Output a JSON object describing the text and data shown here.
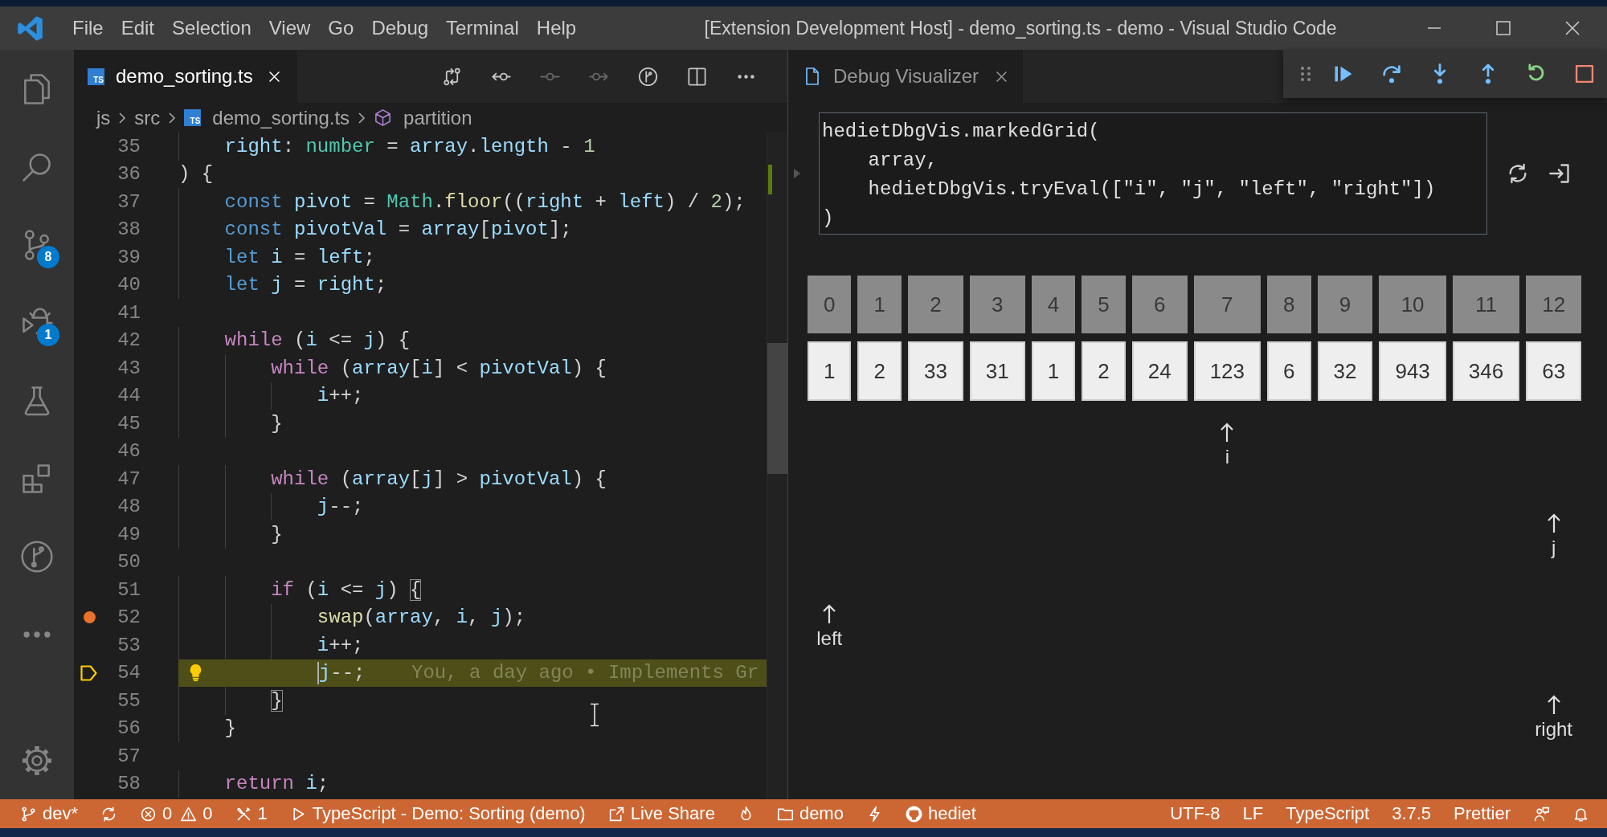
{
  "title_bar": {
    "menu": [
      "File",
      "Edit",
      "Selection",
      "View",
      "Go",
      "Debug",
      "Terminal",
      "Help"
    ],
    "title": "[Extension Development Host] - demo_sorting.ts - demo - Visual Studio Code"
  },
  "activity_bar": {
    "items": [
      {
        "kind": "files",
        "selected": false
      },
      {
        "kind": "search",
        "selected": false
      },
      {
        "kind": "source-control",
        "selected": false,
        "badge": "8"
      },
      {
        "kind": "debug",
        "selected": false,
        "badge": "1"
      },
      {
        "kind": "test",
        "selected": false
      },
      {
        "kind": "extensions",
        "selected": false
      },
      {
        "kind": "git-graph",
        "selected": false
      },
      {
        "kind": "more",
        "selected": false
      },
      {
        "kind": "settings",
        "selected": false
      }
    ]
  },
  "editor": {
    "tabs": [
      {
        "label": "demo_sorting.ts",
        "badge": "TS",
        "selected": true
      }
    ],
    "actions": [
      {
        "kind": "open-changes",
        "disabled": false
      },
      {
        "kind": "previous-revision",
        "disabled": false
      },
      {
        "kind": "revision",
        "disabled": true
      },
      {
        "kind": "next-revision",
        "disabled": true
      },
      {
        "kind": "history",
        "disabled": false
      },
      {
        "kind": "split",
        "disabled": false
      },
      {
        "kind": "more",
        "disabled": false
      }
    ],
    "breadcrumbs": [
      {
        "kind": "folder",
        "label": "js"
      },
      {
        "kind": "folder",
        "label": "src"
      },
      {
        "kind": "file",
        "label": "demo_sorting.ts",
        "badge": "TS"
      },
      {
        "kind": "symbol",
        "label": "partition"
      }
    ],
    "lines": [
      {
        "number": "35",
        "breakpoint": false,
        "current": false,
        "tokens": [
          {
            "text": "    right",
            "kind": "variable"
          },
          {
            "text": ": ",
            "kind": "punctuation"
          },
          {
            "text": "number",
            "kind": "type"
          },
          {
            "text": " = ",
            "kind": "punctuation"
          },
          {
            "text": "array",
            "kind": "variable"
          },
          {
            "text": ".",
            "kind": "punctuation"
          },
          {
            "text": "length",
            "kind": "variable"
          },
          {
            "text": " - ",
            "kind": "punctuation"
          },
          {
            "text": "1",
            "kind": "number"
          }
        ]
      },
      {
        "number": "36",
        "breakpoint": false,
        "current": false,
        "tokens": [
          {
            "text": ") {",
            "kind": "punctuation"
          }
        ]
      },
      {
        "number": "37",
        "breakpoint": false,
        "current": false,
        "tokens": [
          {
            "text": "    const",
            "kind": "storage"
          },
          {
            "text": " pivot",
            "kind": "variable"
          },
          {
            "text": " = ",
            "kind": "punctuation"
          },
          {
            "text": "Math",
            "kind": "type"
          },
          {
            "text": ".",
            "kind": "punctuation"
          },
          {
            "text": "floor",
            "kind": "function"
          },
          {
            "text": "((",
            "kind": "punctuation"
          },
          {
            "text": "right",
            "kind": "variable"
          },
          {
            "text": " + ",
            "kind": "punctuation"
          },
          {
            "text": "left",
            "kind": "variable"
          },
          {
            "text": ") / ",
            "kind": "punctuation"
          },
          {
            "text": "2",
            "kind": "number"
          },
          {
            "text": ");",
            "kind": "punctuation"
          }
        ]
      },
      {
        "number": "38",
        "breakpoint": false,
        "current": false,
        "tokens": [
          {
            "text": "    const",
            "kind": "storage"
          },
          {
            "text": " pivotVal",
            "kind": "variable"
          },
          {
            "text": " = ",
            "kind": "punctuation"
          },
          {
            "text": "array",
            "kind": "variable"
          },
          {
            "text": "[",
            "kind": "punctuation"
          },
          {
            "text": "pivot",
            "kind": "variable"
          },
          {
            "text": "];",
            "kind": "punctuation"
          }
        ]
      },
      {
        "number": "39",
        "breakpoint": false,
        "current": false,
        "tokens": [
          {
            "text": "    let",
            "kind": "storage"
          },
          {
            "text": " i",
            "kind": "variable"
          },
          {
            "text": " = ",
            "kind": "punctuation"
          },
          {
            "text": "left",
            "kind": "variable"
          },
          {
            "text": ";",
            "kind": "punctuation"
          }
        ]
      },
      {
        "number": "40",
        "breakpoint": false,
        "current": false,
        "tokens": [
          {
            "text": "    let",
            "kind": "storage"
          },
          {
            "text": " j",
            "kind": "variable"
          },
          {
            "text": " = ",
            "kind": "punctuation"
          },
          {
            "text": "right",
            "kind": "variable"
          },
          {
            "text": ";",
            "kind": "punctuation"
          }
        ]
      },
      {
        "number": "41",
        "breakpoint": false,
        "current": false
      },
      {
        "number": "42",
        "breakpoint": false,
        "current": false,
        "tokens": [
          {
            "text": "    while",
            "kind": "control"
          },
          {
            "text": " (",
            "kind": "punctuation"
          },
          {
            "text": "i",
            "kind": "variable"
          },
          {
            "text": " <= ",
            "kind": "punctuation"
          },
          {
            "text": "j",
            "kind": "variable"
          },
          {
            "text": ") {",
            "kind": "punctuation"
          }
        ]
      },
      {
        "number": "43",
        "breakpoint": false,
        "current": false,
        "tokens": [
          {
            "text": "        while",
            "kind": "control"
          },
          {
            "text": " (",
            "kind": "punctuation"
          },
          {
            "text": "array",
            "kind": "variable"
          },
          {
            "text": "[",
            "kind": "punctuation"
          },
          {
            "text": "i",
            "kind": "variable"
          },
          {
            "text": "] < ",
            "kind": "punctuation"
          },
          {
            "text": "pivotVal",
            "kind": "variable"
          },
          {
            "text": ") {",
            "kind": "punctuation"
          }
        ]
      },
      {
        "number": "44",
        "breakpoint": false,
        "current": false,
        "tokens": [
          {
            "text": "            i",
            "kind": "variable"
          },
          {
            "text": "++;",
            "kind": "punctuation"
          }
        ]
      },
      {
        "number": "45",
        "breakpoint": false,
        "current": false,
        "tokens": [
          {
            "text": "        }",
            "kind": "punctuation"
          }
        ]
      },
      {
        "number": "46",
        "breakpoint": false,
        "current": false
      },
      {
        "number": "47",
        "breakpoint": false,
        "current": false,
        "tokens": [
          {
            "text": "        while",
            "kind": "control"
          },
          {
            "text": " (",
            "kind": "punctuation"
          },
          {
            "text": "array",
            "kind": "variable"
          },
          {
            "text": "[",
            "kind": "punctuation"
          },
          {
            "text": "j",
            "kind": "variable"
          },
          {
            "text": "] > ",
            "kind": "punctuation"
          },
          {
            "text": "pivotVal",
            "kind": "variable"
          },
          {
            "text": ") {",
            "kind": "punctuation"
          }
        ]
      },
      {
        "number": "48",
        "breakpoint": false,
        "current": false,
        "tokens": [
          {
            "text": "            j",
            "kind": "variable"
          },
          {
            "text": "--;",
            "kind": "punctuation"
          }
        ]
      },
      {
        "number": "49",
        "breakpoint": false,
        "current": false,
        "tokens": [
          {
            "text": "        }",
            "kind": "punctuation"
          }
        ]
      },
      {
        "number": "50",
        "breakpoint": false,
        "current": false
      },
      {
        "number": "51",
        "breakpoint": false,
        "current": false,
        "tokens": [
          {
            "text": "        if",
            "kind": "control"
          },
          {
            "text": " (",
            "kind": "punctuation"
          },
          {
            "text": "i",
            "kind": "variable"
          },
          {
            "text": " <= ",
            "kind": "punctuation"
          },
          {
            "text": "j",
            "kind": "variable"
          },
          {
            "text": ") ",
            "kind": "punctuation"
          },
          {
            "text": "{",
            "kind": "bracket-match"
          }
        ]
      },
      {
        "number": "52",
        "breakpoint": true,
        "current": false,
        "tokens": [
          {
            "text": "            swap",
            "kind": "function"
          },
          {
            "text": "(",
            "kind": "punctuation"
          },
          {
            "text": "array",
            "kind": "variable"
          },
          {
            "text": ", ",
            "kind": "punctuation"
          },
          {
            "text": "i",
            "kind": "variable"
          },
          {
            "text": ", ",
            "kind": "punctuation"
          },
          {
            "text": "j",
            "kind": "variable"
          },
          {
            "text": ");",
            "kind": "punctuation"
          }
        ]
      },
      {
        "number": "53",
        "breakpoint": false,
        "current": false,
        "tokens": [
          {
            "text": "            i",
            "kind": "variable"
          },
          {
            "text": "++;",
            "kind": "punctuation"
          }
        ]
      },
      {
        "number": "54",
        "breakpoint": false,
        "current": true,
        "tokens": [
          {
            "text": "            j",
            "kind": "variable"
          },
          {
            "text": "--;",
            "kind": "punctuation"
          }
        ],
        "annotation": "You, a day ago • Implements Gr"
      },
      {
        "number": "55",
        "breakpoint": false,
        "current": false,
        "tokens": [
          {
            "text": "        }",
            "kind": "bracket-match"
          }
        ]
      },
      {
        "number": "56",
        "breakpoint": false,
        "current": false,
        "tokens": [
          {
            "text": "    }",
            "kind": "punctuation"
          }
        ]
      },
      {
        "number": "57",
        "breakpoint": false,
        "current": false
      },
      {
        "number": "58",
        "breakpoint": false,
        "current": false,
        "tokens": [
          {
            "text": "    return",
            "kind": "control"
          },
          {
            "text": " i",
            "kind": "variable"
          },
          {
            "text": ";",
            "kind": "punctuation"
          }
        ]
      }
    ]
  },
  "debug_toolbar": {
    "actions": [
      {
        "kind": "continue"
      },
      {
        "kind": "step-over"
      },
      {
        "kind": "step-into"
      },
      {
        "kind": "step-out"
      },
      {
        "kind": "restart"
      },
      {
        "kind": "stop"
      }
    ]
  },
  "debug_visualizer": {
    "tabs": [
      {
        "label": "Debug Visualizer",
        "selected": true
      }
    ],
    "expression": [
      "hedietDbgVis.markedGrid(",
      "    array,",
      "    hedietDbgVis.tryEval([\"i\", \"j\", \"left\", \"right\"])",
      ")"
    ],
    "grid": {
      "columns": [
        {
          "index": "0",
          "value": "1"
        },
        {
          "index": "1",
          "value": "2"
        },
        {
          "index": "2",
          "value": "33"
        },
        {
          "index": "3",
          "value": "31"
        },
        {
          "index": "4",
          "value": "1"
        },
        {
          "index": "5",
          "value": "2"
        },
        {
          "index": "6",
          "value": "24"
        },
        {
          "index": "7",
          "value": "123"
        },
        {
          "index": "8",
          "value": "6"
        },
        {
          "index": "9",
          "value": "32"
        },
        {
          "index": "10",
          "value": "943"
        },
        {
          "index": "11",
          "value": "346"
        },
        {
          "index": "12",
          "value": "63"
        }
      ],
      "marker_rows": [
        {
          "cells": [
            {
              "marked": false
            },
            {
              "marked": false
            },
            {
              "marked": false
            },
            {
              "marked": false
            },
            {
              "marked": false
            },
            {
              "marked": false
            },
            {
              "marked": false
            },
            {
              "marked": true,
              "label": "i"
            },
            {
              "marked": false
            },
            {
              "marked": false
            },
            {
              "marked": false
            },
            {
              "marked": false
            },
            {
              "marked": false
            }
          ]
        },
        {
          "cells": [
            {
              "marked": false
            },
            {
              "marked": false
            },
            {
              "marked": false
            },
            {
              "marked": false
            },
            {
              "marked": false
            },
            {
              "marked": false
            },
            {
              "marked": false
            },
            {
              "marked": false
            },
            {
              "marked": false
            },
            {
              "marked": false
            },
            {
              "marked": false
            },
            {
              "marked": false
            },
            {
              "marked": true,
              "label": "j"
            }
          ]
        },
        {
          "cells": [
            {
              "marked": true,
              "label": "left"
            },
            {
              "marked": false
            },
            {
              "marked": false
            },
            {
              "marked": false
            },
            {
              "marked": false
            },
            {
              "marked": false
            },
            {
              "marked": false
            },
            {
              "marked": false
            },
            {
              "marked": false
            },
            {
              "marked": false
            },
            {
              "marked": false
            },
            {
              "marked": false
            },
            {
              "marked": false
            }
          ]
        },
        {
          "cells": [
            {
              "marked": false
            },
            {
              "marked": false
            },
            {
              "marked": false
            },
            {
              "marked": false
            },
            {
              "marked": false
            },
            {
              "marked": false
            },
            {
              "marked": false
            },
            {
              "marked": false
            },
            {
              "marked": false
            },
            {
              "marked": false
            },
            {
              "marked": false
            },
            {
              "marked": false
            },
            {
              "marked": true,
              "label": "right"
            }
          ]
        }
      ]
    }
  },
  "status_bar": {
    "left": [
      {
        "kind": "branch",
        "text": "dev*"
      },
      {
        "kind": "sync"
      },
      {
        "kind": "errors",
        "text": "0"
      },
      {
        "kind": "warnings",
        "text": "0"
      },
      {
        "kind": "tools",
        "text": "1"
      },
      {
        "kind": "debug",
        "text": "TypeScript - Demo: Sorting (demo)"
      },
      {
        "kind": "live-share",
        "text": "Live Share"
      },
      {
        "kind": "flame"
      },
      {
        "kind": "folder",
        "text": "demo"
      },
      {
        "kind": "lightning"
      },
      {
        "kind": "github",
        "text": "hediet"
      }
    ],
    "right": [
      {
        "kind": "text",
        "text": "UTF-8"
      },
      {
        "kind": "text",
        "text": "LF"
      },
      {
        "kind": "text",
        "text": "TypeScript"
      },
      {
        "kind": "text",
        "text": "3.7.5"
      },
      {
        "kind": "text",
        "text": "Prettier"
      },
      {
        "kind": "feedback"
      },
      {
        "kind": "bell"
      }
    ]
  }
}
